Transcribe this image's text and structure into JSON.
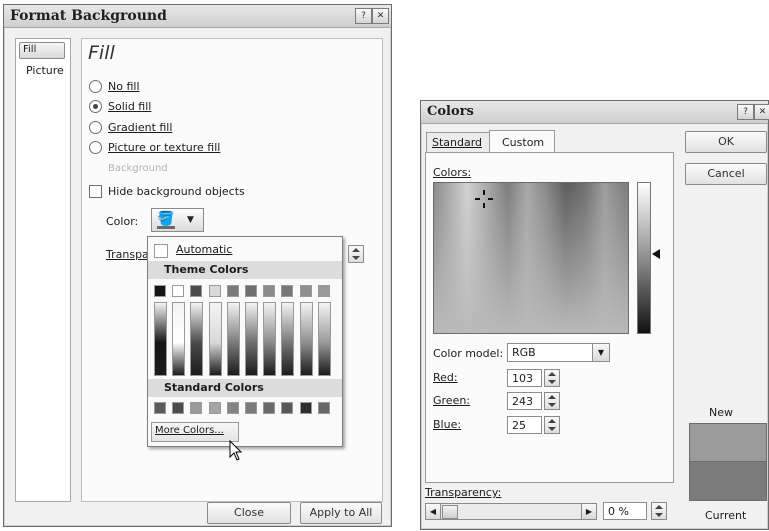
{
  "format_background": {
    "title": "Format Background",
    "sidebar": [
      "Fill",
      "Picture"
    ],
    "heading": "Fill",
    "options": [
      "No fill",
      "Solid fill",
      "Gradient fill",
      "Picture or texture fill"
    ],
    "disabled_option": "Background",
    "hide_label": "Hide background objects",
    "color_label": "Color:",
    "transparency_label": "Transpa",
    "close_label": "Close",
    "apply_all_label": "Apply to All"
  },
  "color_popup": {
    "automatic": "Automatic",
    "theme_heading": "Theme Colors",
    "standard_heading": "Standard Colors",
    "more_colors": "More Colors..."
  },
  "colors_dialog": {
    "title": "Colors",
    "tabs": [
      "Standard",
      "Custom"
    ],
    "ok_label": "OK",
    "cancel_label": "Cancel",
    "colors_label": "Colors:",
    "model_label": "Color model:",
    "model_value": "RGB",
    "red_label": "Red:",
    "red_value": "103",
    "green_label": "Green:",
    "green_value": "243",
    "blue_label": "Blue:",
    "blue_value": "25",
    "transparency_label": "Transparency:",
    "transparency_value": "0 %",
    "new_label": "New",
    "current_label": "Current"
  },
  "colors": {
    "theme_top": [
      "#151515",
      "#ffffff",
      "#4a4a4a",
      "#d9d9d9",
      "#7a7a7a",
      "#6e6e6e",
      "#8a8a8a",
      "#777777",
      "#8f8f8f",
      "#999999"
    ],
    "standard": [
      "#5a5a5a",
      "#4c4c4c",
      "#9a9a9a",
      "#a5a5a5",
      "#848484",
      "#7a7a7a",
      "#6a6a6a",
      "#585858",
      "#2f2f2f",
      "#676767"
    ]
  }
}
